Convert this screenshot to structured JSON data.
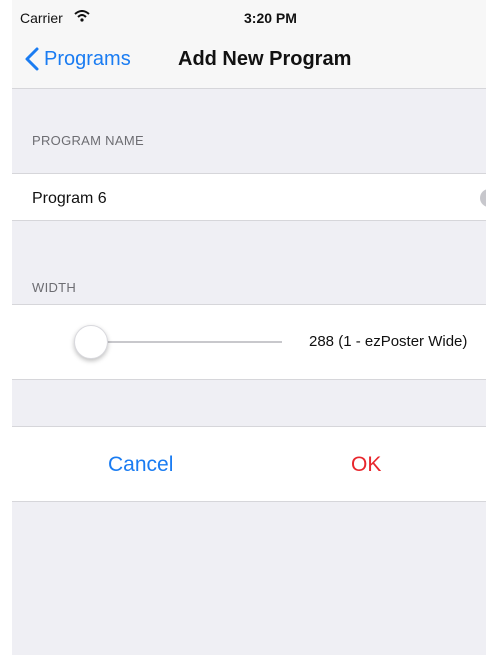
{
  "status_bar": {
    "carrier": "Carrier",
    "time": "3:20 PM"
  },
  "nav": {
    "back_label": "Programs",
    "title": "Add New Program"
  },
  "program_name": {
    "header": "PROGRAM NAME",
    "value": "Program 6"
  },
  "width": {
    "header": "WIDTH",
    "value_label": "288 (1 - ezPoster Wide)",
    "slider_position": 0.0
  },
  "actions": {
    "cancel_label": "Cancel",
    "ok_label": "OK"
  },
  "colors": {
    "accent": "#1a7cf2",
    "destructive": "#e8262c",
    "background": "#efeff4"
  },
  "icons": {
    "back": "chevron-left-icon",
    "wifi": "wifi-icon",
    "clear": "clear-text-icon"
  }
}
